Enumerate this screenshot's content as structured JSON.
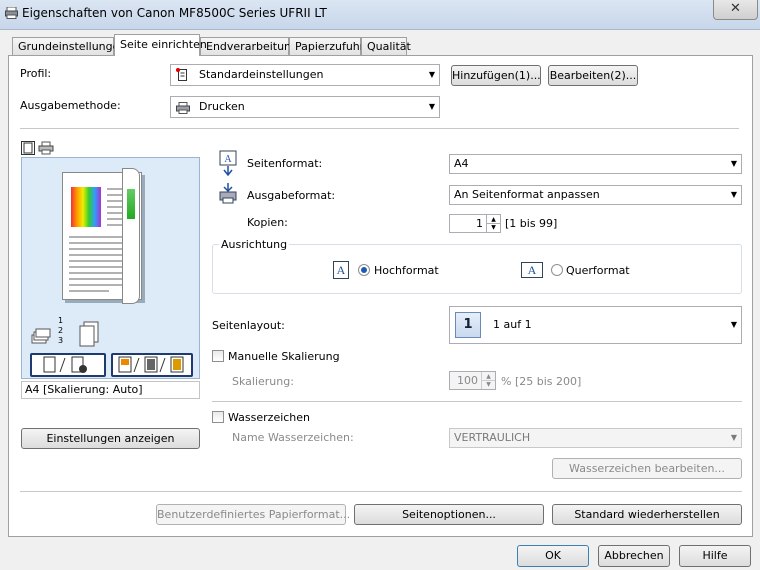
{
  "window": {
    "title": "Eigenschaften von Canon MF8500C Series UFRII LT",
    "close_symbol": "✕"
  },
  "tabs": [
    {
      "label": "Grundeinstellungen"
    },
    {
      "label": "Seite einrichten"
    },
    {
      "label": "Endverarbeitung"
    },
    {
      "label": "Papierzufuhr"
    },
    {
      "label": "Qualität"
    }
  ],
  "profile": {
    "label": "Profil:",
    "value": "Standardeinstellungen",
    "add_button": "Hinzufügen(1)...",
    "edit_button": "Bearbeiten(2)..."
  },
  "output": {
    "label": "Ausgabemethode:",
    "value": "Drucken"
  },
  "preview": {
    "caption": "A4 [Skalierung: Auto]",
    "show_settings_button": "Einstellungen anzeigen",
    "page_numbers": [
      "1",
      "2",
      "3"
    ]
  },
  "page_size": {
    "label": "Seitenformat:",
    "value": "A4"
  },
  "output_size": {
    "label": "Ausgabeformat:",
    "value": "An Seitenformat anpassen"
  },
  "copies": {
    "label": "Kopien:",
    "value": "1",
    "range": "[1 bis 99]"
  },
  "orientation": {
    "group_label": "Ausrichtung",
    "icon_letter": "A",
    "portrait": "Hochformat",
    "landscape": "Querformat"
  },
  "layout": {
    "label": "Seitenlayout:",
    "badge": "1",
    "value": "1 auf 1"
  },
  "scaling": {
    "manual_label": "Manuelle Skalierung",
    "label": "Skalierung:",
    "value": "100",
    "range": "% [25 bis 200]"
  },
  "watermark": {
    "label": "Wasserzeichen",
    "name_label": "Name Wasserzeichen:",
    "value": "VERTRAULICH",
    "edit_button": "Wasserzeichen bearbeiten..."
  },
  "bottom_buttons": {
    "custom_paper": "Benutzerdefiniertes Papierformat...",
    "page_options": "Seitenoptionen...",
    "restore": "Standard wiederherstellen"
  },
  "dialog_buttons": {
    "ok": "OK",
    "cancel": "Abbrechen",
    "help": "Hilfe"
  },
  "dropdown_arrow": "▼",
  "spin_up": "▲",
  "spin_down": "▼"
}
